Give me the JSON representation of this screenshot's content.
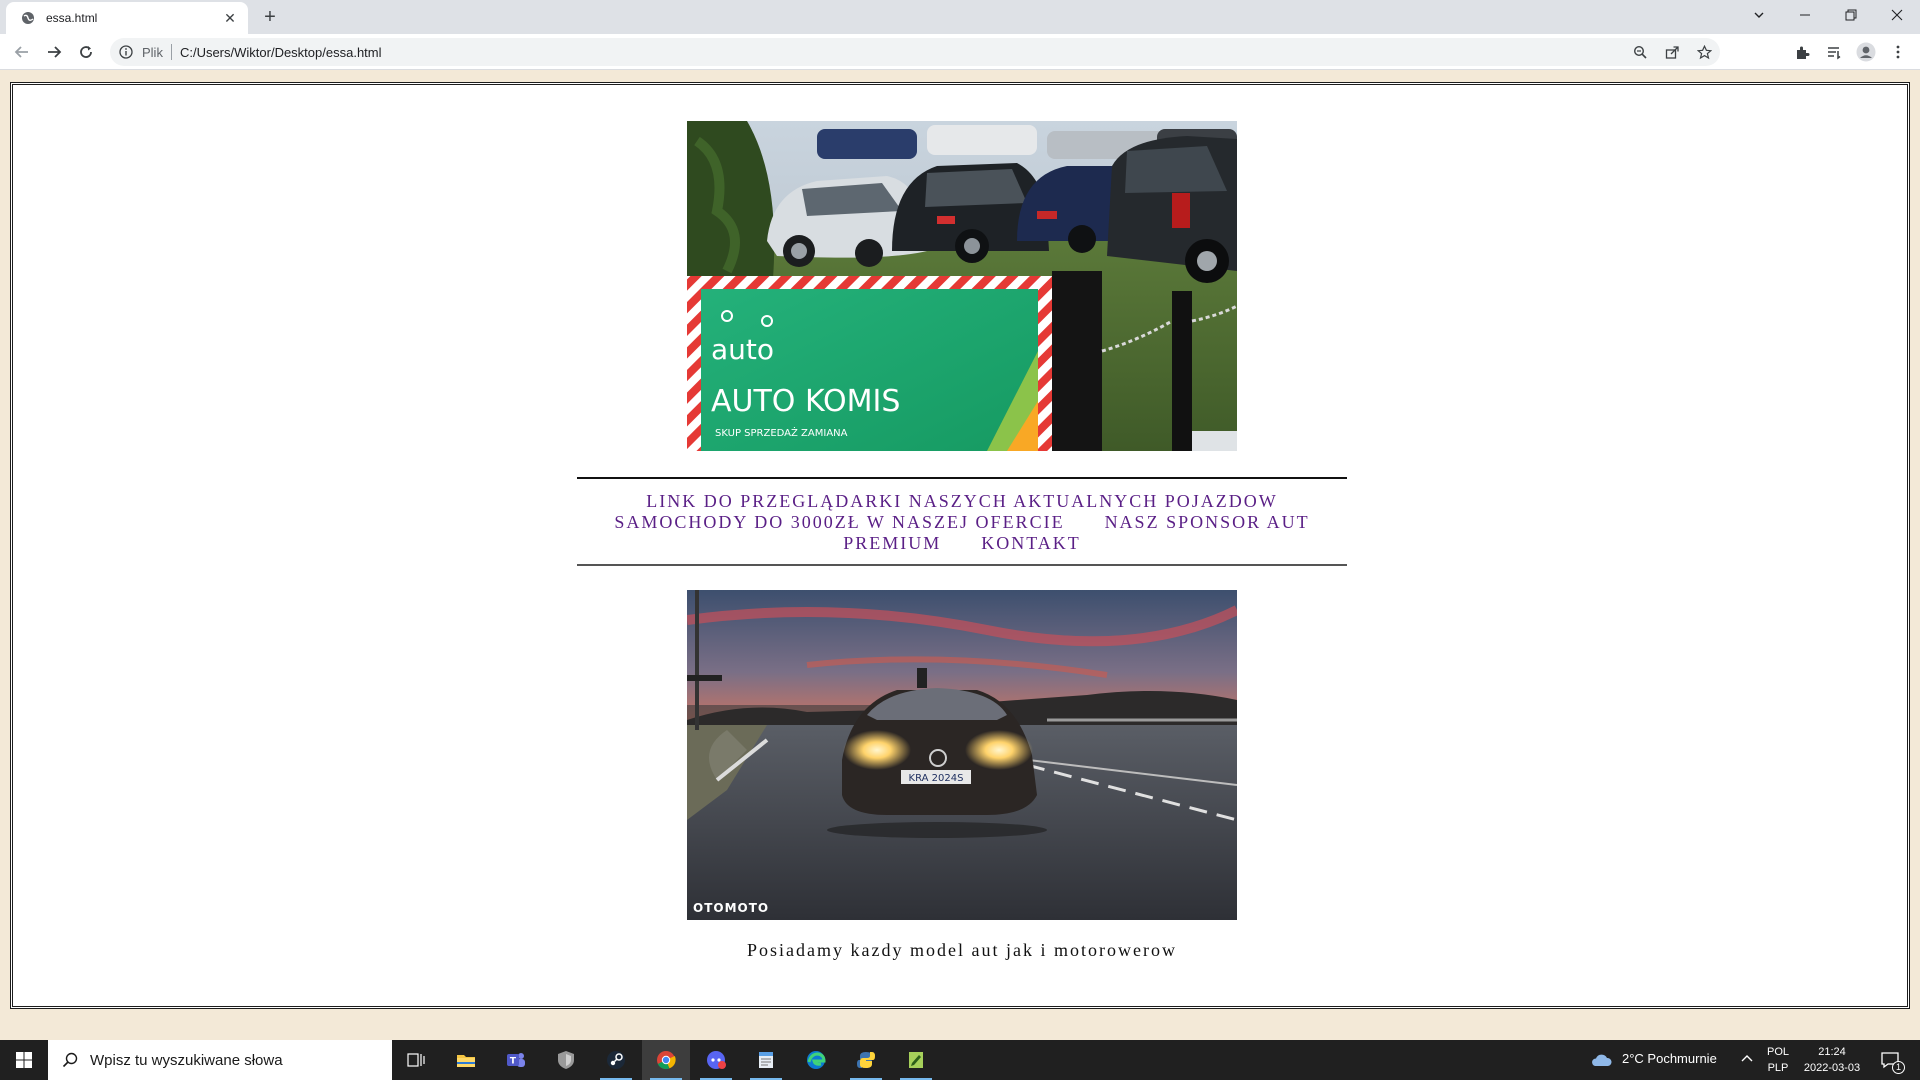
{
  "browser": {
    "tab_title": "essa.html",
    "tab_close": "✕",
    "new_tab": "+",
    "omnibox_label": "Plik",
    "url": "C:/Users/Wiktor/Desktop/essa.html"
  },
  "page": {
    "hero_sign_brand": "auto",
    "hero_sign_title": "AUTO KOMIS",
    "hero_sign_sub": "SKUP  SPRZEDAŻ  ZAMIANA",
    "nav": {
      "link1": "LINK DO PRZEGLĄDARKI NASZYCH AKTUALNYCH POJAZDOW",
      "link2": "SAMOCHODY DO 3000ZŁ W NASZEJ OFERCIE",
      "link3": "NASZ SPONSOR AUT PREMIUM",
      "link4": "KONTAKT"
    },
    "car_plate": "KRA 2024S",
    "car_watermark": "OTOMOTO",
    "bottom_text": "Posiadamy kazdy model aut jak i motorowerow"
  },
  "taskbar": {
    "search_placeholder": "Wpisz tu wyszukiwane słowa",
    "weather": "2°C  Pochmurnie",
    "lang_top": "POL",
    "lang_bottom": "PLP",
    "time": "21:24",
    "date": "2022-03-03",
    "notification_count": "1"
  },
  "colors": {
    "page_bg": "#f3e9d7",
    "nav_link": "#5a1f86",
    "sign_green": "#1faa6e"
  }
}
